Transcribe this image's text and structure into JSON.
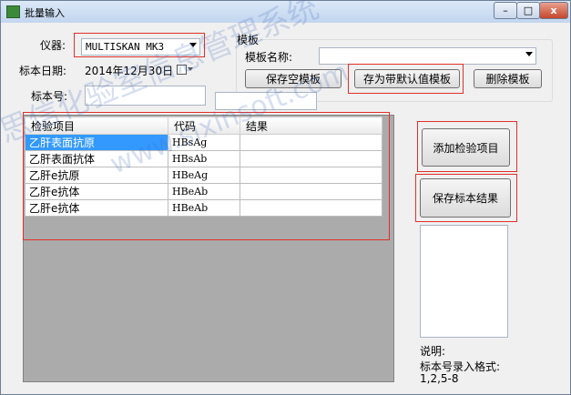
{
  "window": {
    "title": "批量输入",
    "minimize": "–",
    "maximize": "□",
    "close": "x"
  },
  "form": {
    "instrument_label": "仪器:",
    "instrument_value": "MULTISKAN MK3",
    "date_label": "标本日期:",
    "date_value": "2014年12月30日",
    "date_icon": "calendar-icon",
    "sample_no_label": "标本号:",
    "sample_no_value": ""
  },
  "template": {
    "group_label": "模板",
    "name_label": "模板名称:",
    "name_value": "",
    "save_empty": "保存空模板",
    "save_default": "存为带默认值模板",
    "delete": "删除模板"
  },
  "grid": {
    "headers": [
      "检验项目",
      "代码",
      "结果"
    ],
    "rows": [
      {
        "item": "乙肝表面抗原",
        "code": "HBsAg",
        "result": ""
      },
      {
        "item": "乙肝表面抗体",
        "code": "HBsAb",
        "result": ""
      },
      {
        "item": "乙肝e抗原",
        "code": "HBeAg",
        "result": ""
      },
      {
        "item": "乙肝e抗体",
        "code": "HBeAb",
        "result": ""
      },
      {
        "item": "乙肝e抗体",
        "code": "HBeAb",
        "result": ""
      }
    ]
  },
  "actions": {
    "add_item": "添加检验项目",
    "save_result": "保存标本结果"
  },
  "help": {
    "title": "说明:",
    "line1": "标本号录入格式:",
    "line2": "1,2,5-8"
  },
  "watermark": {
    "line1": "思信化验室信息管理系统",
    "line2": "www.sixinsoft.com"
  },
  "colors": {
    "highlight_box": "#e0302a",
    "selection": "#3399ff",
    "grid_background": "#ababab"
  }
}
